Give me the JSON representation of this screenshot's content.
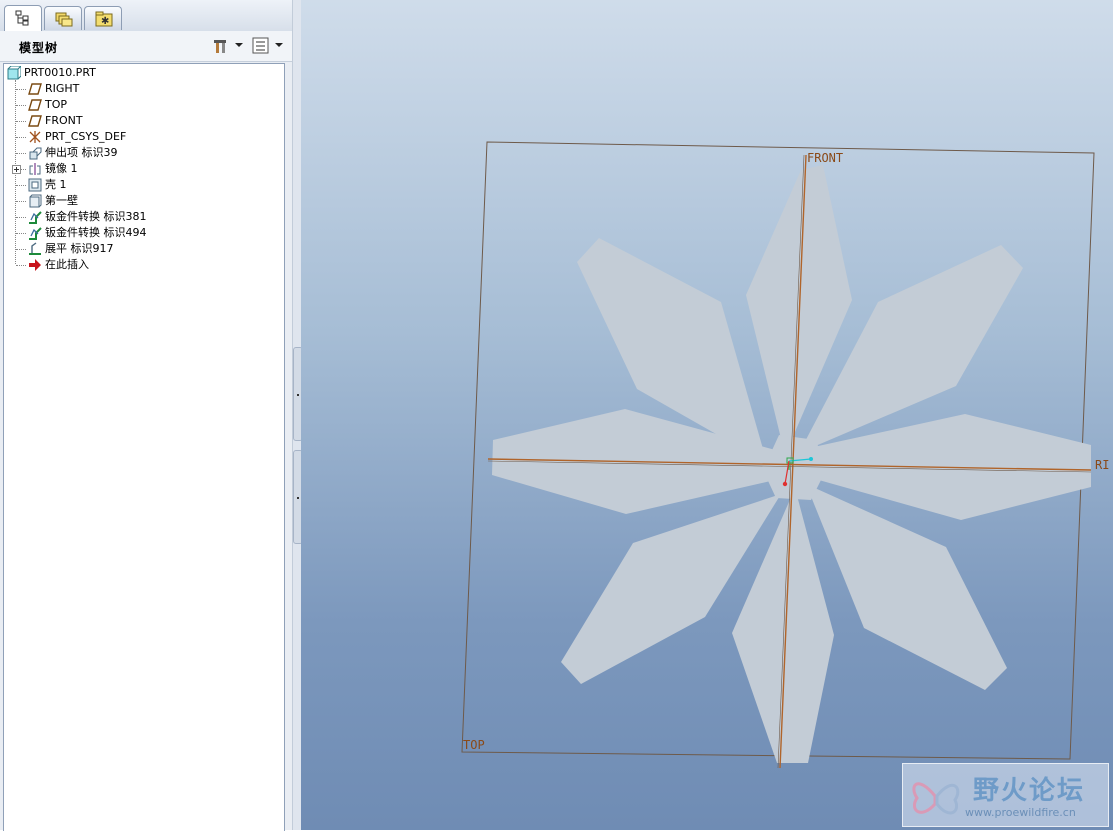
{
  "tabs": [
    {
      "icon": "model-tree-tab-icon"
    },
    {
      "icon": "folder-browser-tab-icon"
    },
    {
      "icon": "favorites-tab-icon"
    }
  ],
  "model_tree": {
    "title": "模型树",
    "settings_icon": "tools-icon",
    "show_icon": "tree-filter-icon",
    "items": [
      {
        "label": "PRT0010.PRT",
        "icon": "part-icon"
      },
      {
        "label": "RIGHT",
        "icon": "datum-plane-icon"
      },
      {
        "label": "TOP",
        "icon": "datum-plane-icon"
      },
      {
        "label": "FRONT",
        "icon": "datum-plane-icon"
      },
      {
        "label": "PRT_CSYS_DEF",
        "icon": "csys-icon"
      },
      {
        "label": "伸出项 标识39",
        "icon": "protrusion-icon"
      },
      {
        "label": "镜像 1",
        "icon": "mirror-icon"
      },
      {
        "label": "壳 1",
        "icon": "shell-icon"
      },
      {
        "label": "第一壁",
        "icon": "first-wall-icon"
      },
      {
        "label": "钣金件转换 标识381",
        "icon": "sheetmetal-convert-icon"
      },
      {
        "label": "钣金件转换 标识494",
        "icon": "sheetmetal-convert-icon"
      },
      {
        "label": "展平 标识917",
        "icon": "unbend-icon"
      },
      {
        "label": "在此插入",
        "icon": "insert-here-arrow-icon"
      }
    ]
  },
  "viewport": {
    "datum_labels": {
      "front": "FRONT",
      "right": "RI",
      "top": "TOP"
    },
    "colors": {
      "background_top": "#cfdcea",
      "background_bottom": "#6f8cb4",
      "part_fill": "#c3ccd6",
      "datum": "#b0642a"
    }
  },
  "watermark": {
    "text": "野火论坛",
    "url": "www.proewildfire.cn"
  }
}
